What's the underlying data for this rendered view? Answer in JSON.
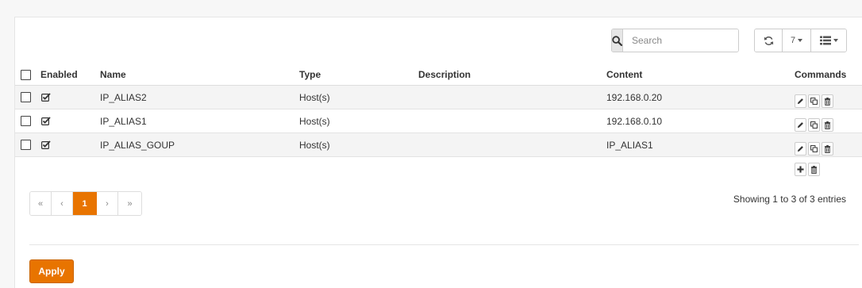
{
  "search": {
    "placeholder": "Search"
  },
  "toolbar": {
    "row_count": "7"
  },
  "table": {
    "headers": {
      "enabled": "Enabled",
      "name": "Name",
      "type": "Type",
      "description": "Description",
      "content": "Content",
      "commands": "Commands"
    },
    "rows": [
      {
        "enabled": true,
        "name": "IP_ALIAS2",
        "type": "Host(s)",
        "description": "",
        "content": "192.168.0.20"
      },
      {
        "enabled": true,
        "name": "IP_ALIAS1",
        "type": "Host(s)",
        "description": "",
        "content": "192.168.0.10"
      },
      {
        "enabled": true,
        "name": "IP_ALIAS_GOUP",
        "type": "Host(s)",
        "description": "",
        "content": "IP_ALIAS1"
      }
    ]
  },
  "pagination": {
    "first": "«",
    "prev": "‹",
    "current": "1",
    "next": "›",
    "last": "»"
  },
  "status": {
    "showing": "Showing 1 to 3 of 3 entries"
  },
  "actions": {
    "apply_label": "Apply"
  },
  "colors": {
    "accent": "#e87400"
  },
  "icons": [
    "search-icon",
    "refresh-icon",
    "list-columns-icon",
    "checked-box-icon",
    "edit-icon",
    "copy-icon",
    "trash-icon",
    "plus-icon"
  ]
}
